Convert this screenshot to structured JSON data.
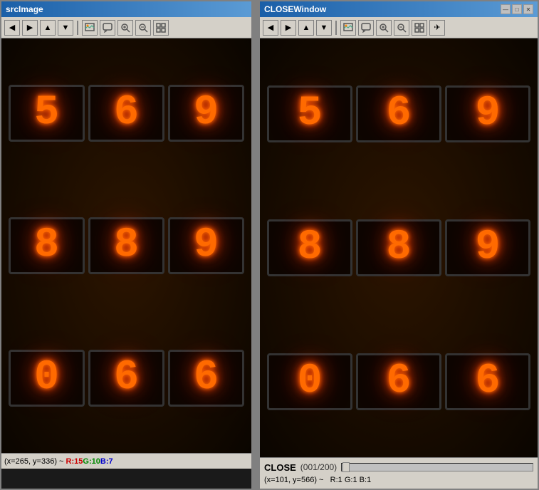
{
  "windows": {
    "left": {
      "title": "srcImage",
      "toolbar_buttons": [
        "◀",
        "▶",
        "▲",
        "▼",
        "🖼",
        "💬",
        "🔍",
        "🔎",
        "⛶"
      ],
      "digits": {
        "row1": [
          "5",
          "6",
          "9"
        ],
        "row2": [
          "8",
          "8",
          "9"
        ],
        "row3": [
          "0",
          "6",
          "6"
        ]
      },
      "status": {
        "coord": "(x=265, y=336) ~",
        "r_label": "R:",
        "r_val": "15",
        "g_label": " G:",
        "g_val": "10",
        "b_label": " B:",
        "b_val": "7"
      }
    },
    "right": {
      "title": "CLOSEWindow",
      "title_buttons": [
        "—",
        "□",
        "✕"
      ],
      "toolbar_buttons": [
        "◀",
        "▶",
        "▲",
        "▼",
        "🖼",
        "💬",
        "🔍",
        "🔎",
        "⛶",
        "✈"
      ],
      "digits": {
        "row1": [
          "5",
          "6",
          "9"
        ],
        "row2": [
          "8",
          "8",
          "9"
        ],
        "row3": [
          "0",
          "6",
          "6"
        ]
      },
      "bottom": {
        "close_label": "CLOSE",
        "frame_info": "(001/200)",
        "slider_min": 0,
        "slider_max": 200,
        "slider_value": 1,
        "coord": "(x=101, y=566) ~",
        "r_label": "R:",
        "r_val": "1",
        "g_label": " G:",
        "g_val": "1",
        "b_label": " B:",
        "b_val": "1"
      }
    }
  }
}
